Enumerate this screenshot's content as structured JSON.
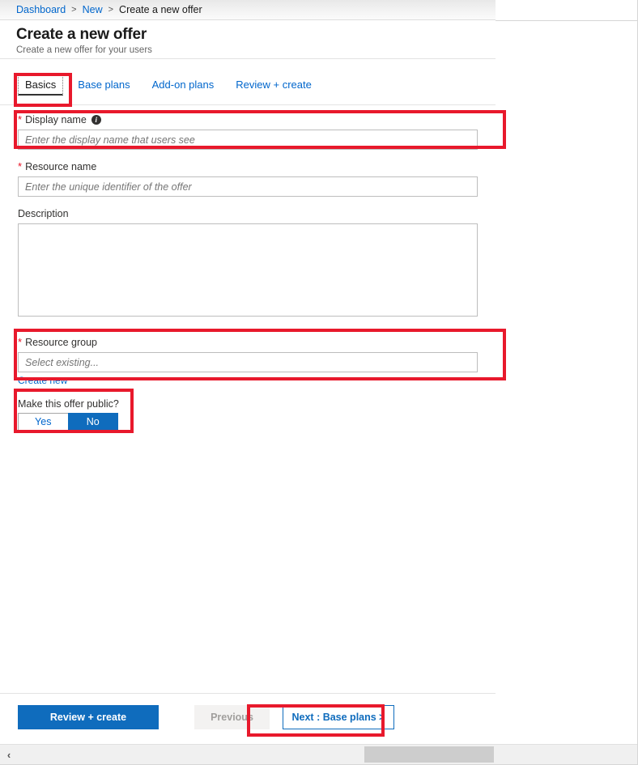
{
  "breadcrumb": {
    "items": [
      {
        "label": "Dashboard",
        "link": true
      },
      {
        "label": "New",
        "link": true
      },
      {
        "label": "Create a new offer",
        "link": false
      }
    ],
    "separator": ">"
  },
  "header": {
    "title": "Create a new offer",
    "subtitle": "Create a new offer for your users"
  },
  "tabs": [
    {
      "label": "Basics",
      "active": true
    },
    {
      "label": "Base plans",
      "active": false
    },
    {
      "label": "Add-on plans",
      "active": false
    },
    {
      "label": "Review + create",
      "active": false
    }
  ],
  "form": {
    "display_name": {
      "label": "Display name",
      "required_mark": "*",
      "info_icon": "info-icon",
      "info_glyph": "i",
      "value": "",
      "placeholder": "Enter the display name that users see"
    },
    "resource_name": {
      "label": "Resource name",
      "required_mark": "*",
      "value": "",
      "placeholder": "Enter the unique identifier of the offer"
    },
    "description": {
      "label": "Description",
      "value": "",
      "placeholder": ""
    },
    "resource_group": {
      "label": "Resource group",
      "required_mark": "*",
      "value": "",
      "placeholder": "Select existing...",
      "create_new_label": "Create new"
    },
    "make_public": {
      "label": "Make this offer public?",
      "options": [
        "Yes",
        "No"
      ],
      "selected": "No"
    }
  },
  "footer": {
    "review_create_label": "Review + create",
    "previous_label": "Previous",
    "next_label": "Next : Base plans >"
  },
  "scrollbar": {
    "left_arrow_glyph": "‹"
  },
  "colors": {
    "accent_blue": "#0f6cbd",
    "link_blue": "#0066cc",
    "required_red": "#e81123",
    "annotation_red": "#e8192c",
    "disabled_gray": "#a19f9d"
  }
}
